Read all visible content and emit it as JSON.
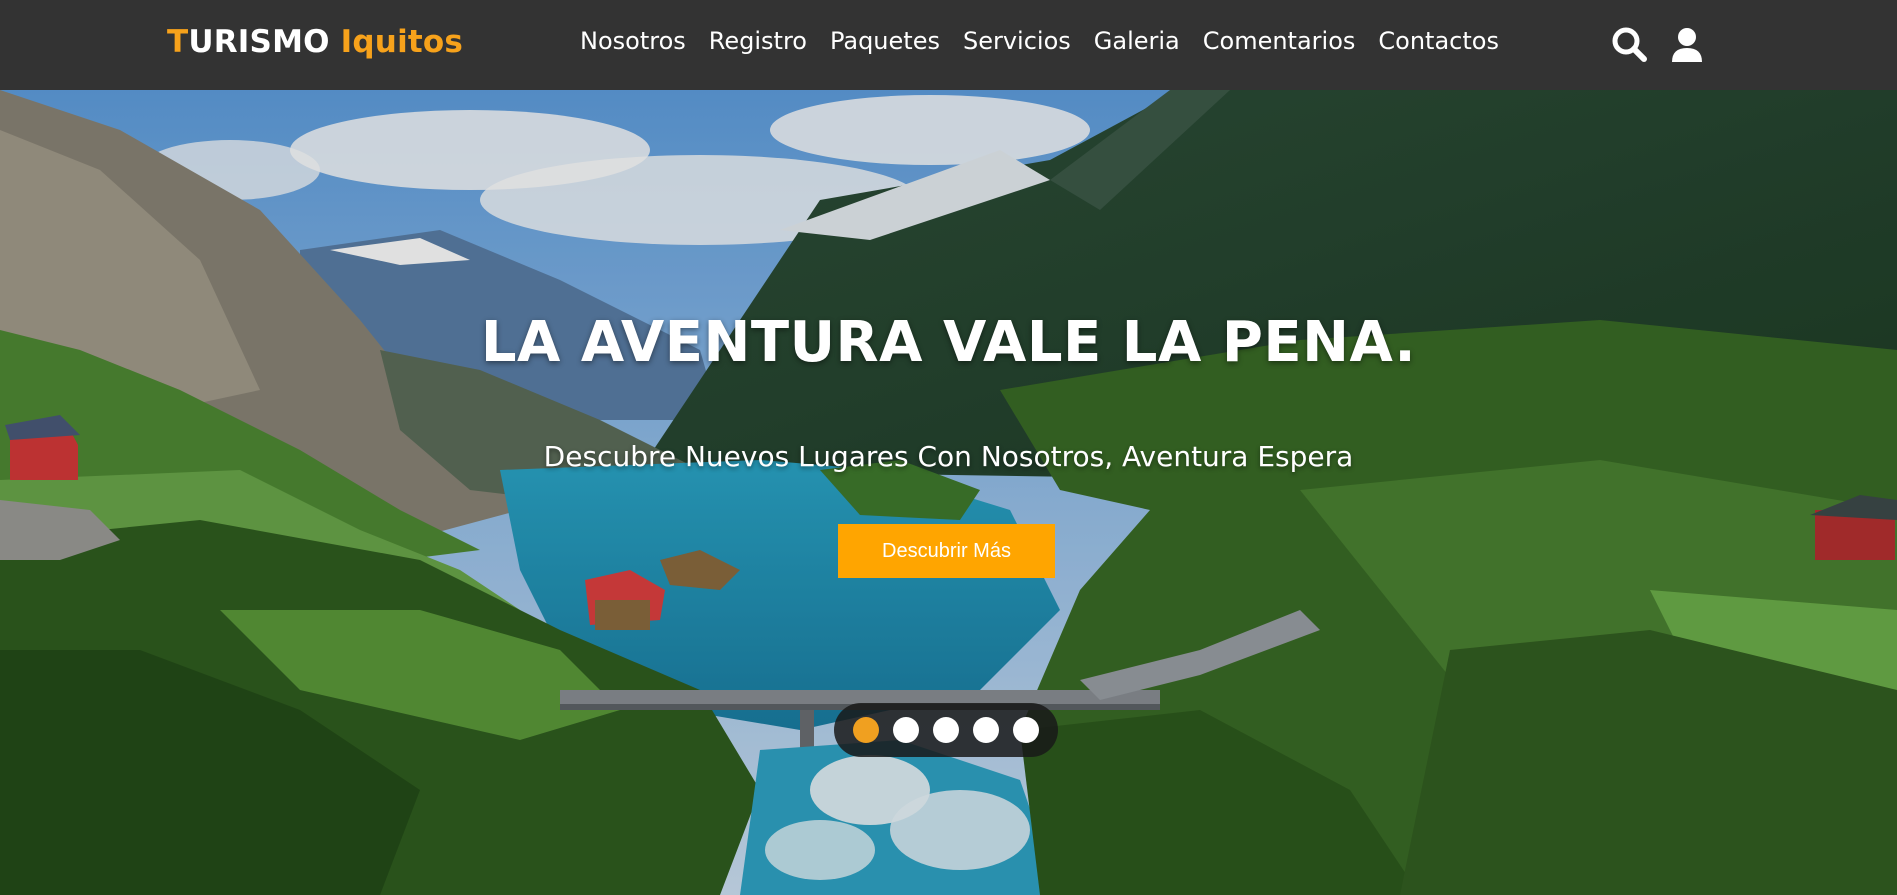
{
  "brand": {
    "first_letter": "T",
    "rest": "URISMO",
    "highlight": "Iquitos",
    "accent_color": "#f7a21b"
  },
  "nav": {
    "items": [
      {
        "label": "Nosotros"
      },
      {
        "label": "Registro"
      },
      {
        "label": "Paquetes"
      },
      {
        "label": "Servicios"
      },
      {
        "label": "Galeria"
      },
      {
        "label": "Comentarios"
      },
      {
        "label": "Contactos"
      }
    ],
    "icons": [
      "search-icon",
      "user-icon"
    ],
    "background": "#333333"
  },
  "hero": {
    "title": "LA AVENTURA VALE LA PENA.",
    "subtitle": "Descubre Nuevos Lugares Con Nosotros, Aventura Espera",
    "button_label": "Descubrir Más",
    "button_color": "#ffa500",
    "slider": {
      "count": 5,
      "active_index": 0,
      "active_color": "#f0a020"
    }
  }
}
